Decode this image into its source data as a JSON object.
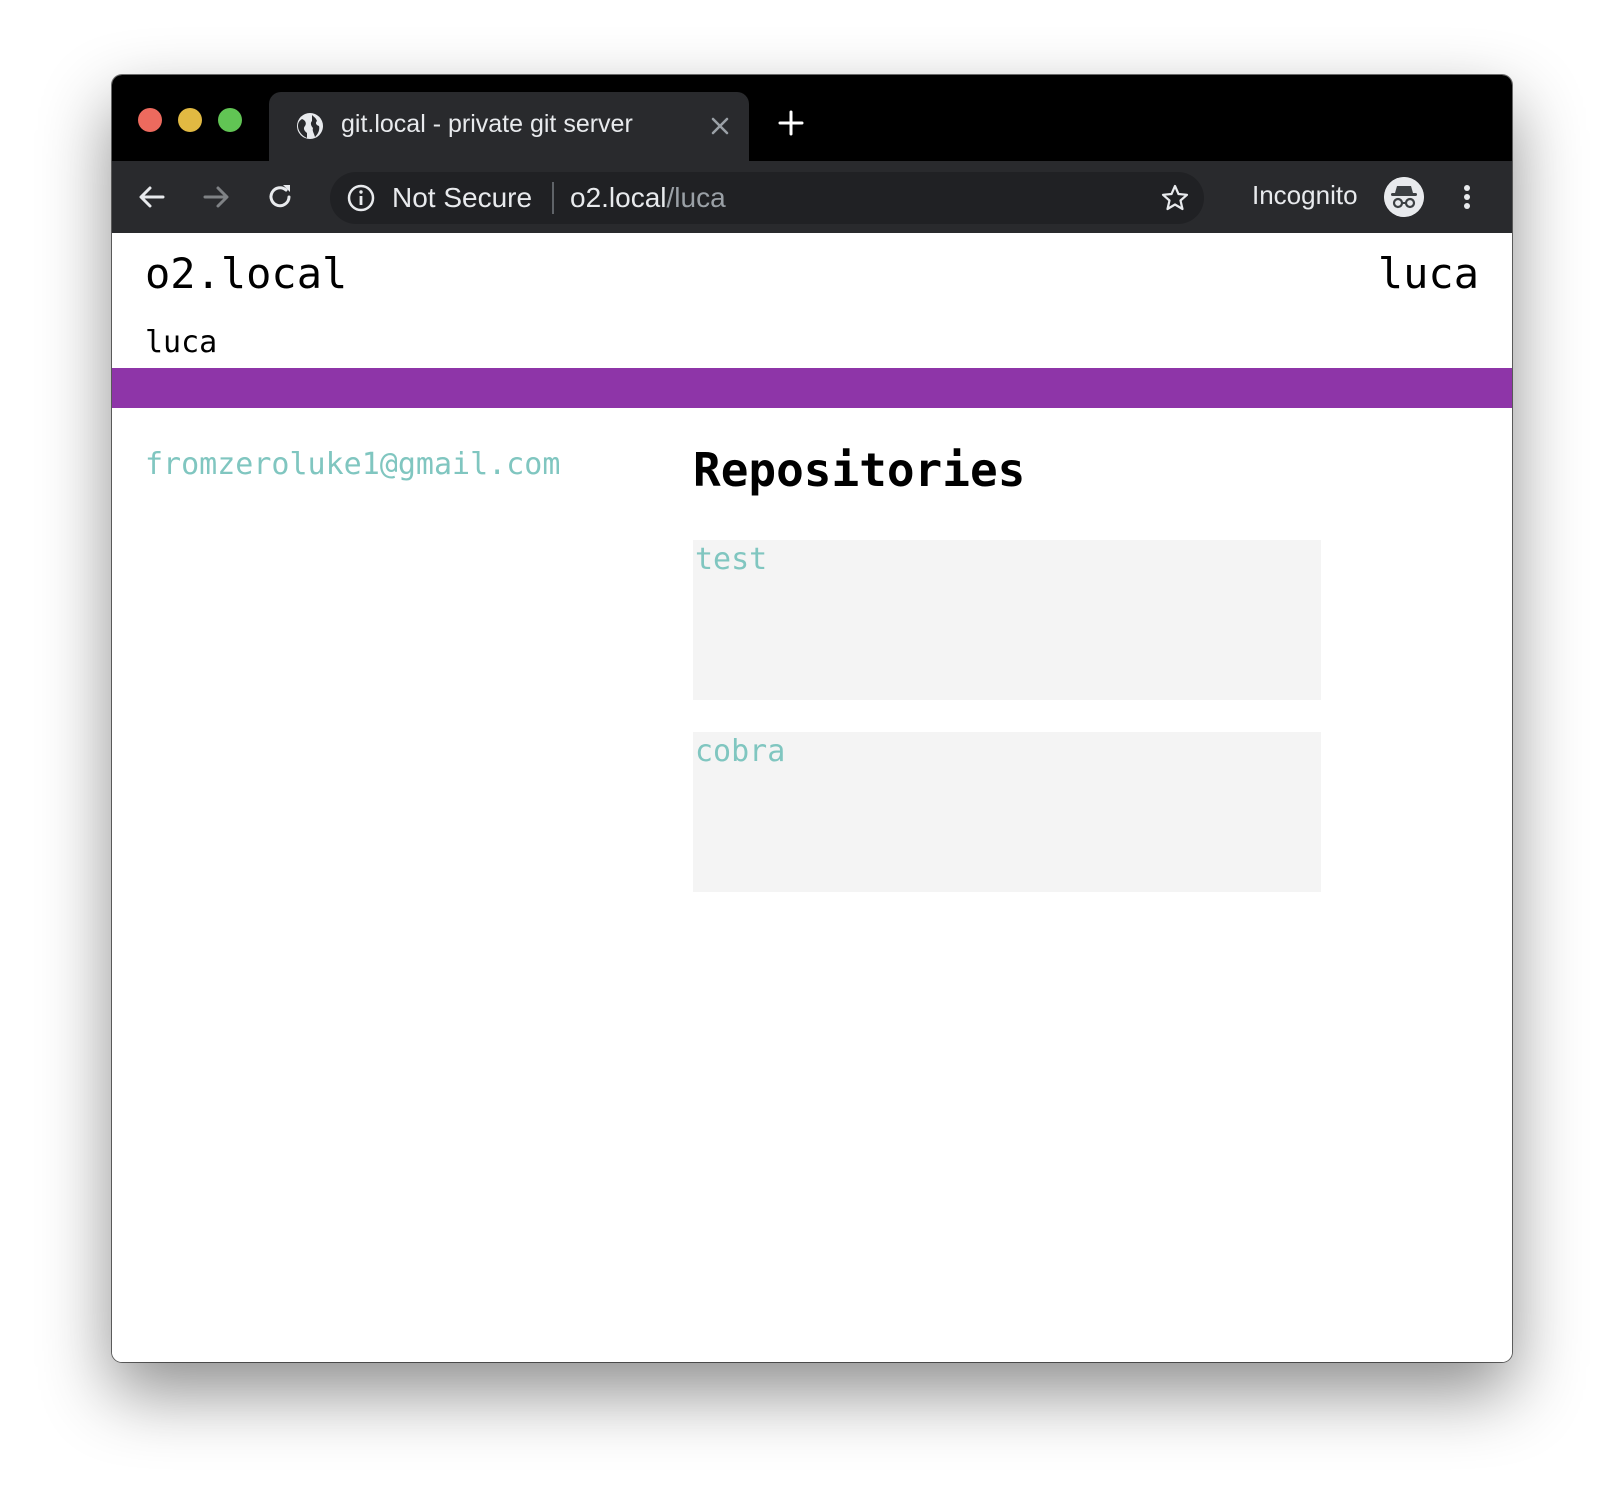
{
  "browser": {
    "tab": {
      "title": "git.local - private git server",
      "icon": "globe-icon",
      "close_icon": "close-icon"
    },
    "new_tab_icon": "plus-icon",
    "nav": {
      "back_icon": "arrow-left-icon",
      "forward_icon": "arrow-right-icon",
      "reload_icon": "reload-icon"
    },
    "omnibox": {
      "security_icon": "info-icon",
      "security_label": "Not Secure",
      "url_host": "o2.local",
      "url_path": "/luca",
      "bookmark_icon": "star-icon"
    },
    "profile": {
      "label": "Incognito",
      "avatar_icon": "incognito-icon"
    },
    "menu_icon": "kebab-menu-icon",
    "window_controls": {
      "close_color": "#ed6a5e",
      "minimize_color": "#e1b942",
      "maximize_color": "#61c554"
    }
  },
  "site": {
    "title": "o2.local",
    "current_user": "luca",
    "page_subtitle": "luca",
    "accent_color": "#8e35a8",
    "link_color": "#80c6c0"
  },
  "profile": {
    "email": "fromzeroluke1@gmail.com"
  },
  "repositories": {
    "heading": "Repositories",
    "items": [
      {
        "name": "test"
      },
      {
        "name": "cobra"
      }
    ]
  }
}
